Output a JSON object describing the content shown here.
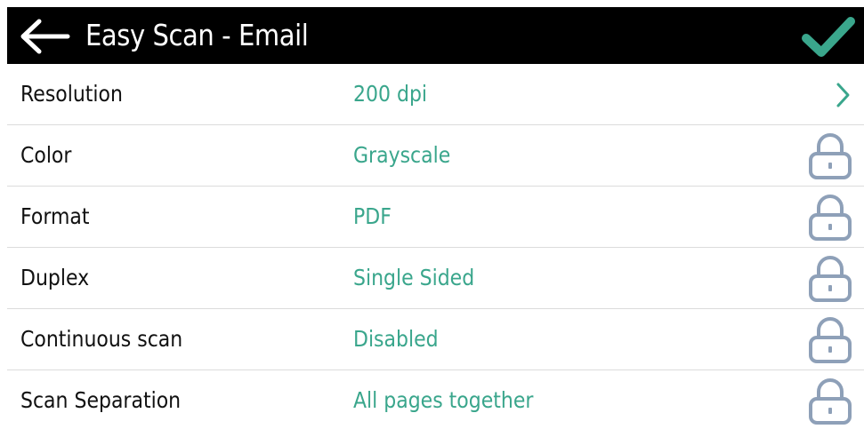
{
  "colors": {
    "header_bg": "#000000",
    "header_text": "#ffffff",
    "accent": "#3aa68c",
    "lock": "#8ea0b8",
    "label": "#111111",
    "divider": "#dcdcdc"
  },
  "header": {
    "back_icon": "arrow-left-icon",
    "title": "Easy Scan - Email",
    "confirm_icon": "checkmark-icon"
  },
  "settings": [
    {
      "label": "Resolution",
      "value": "200 dpi",
      "trailing_icon": "chevron-right-icon",
      "locked": false
    },
    {
      "label": "Color",
      "value": "Grayscale",
      "trailing_icon": "lock-icon",
      "locked": true
    },
    {
      "label": "Format",
      "value": "PDF",
      "trailing_icon": "lock-icon",
      "locked": true
    },
    {
      "label": "Duplex",
      "value": "Single Sided",
      "trailing_icon": "lock-icon",
      "locked": true
    },
    {
      "label": "Continuous scan",
      "value": "Disabled",
      "trailing_icon": "lock-icon",
      "locked": true
    },
    {
      "label": "Scan Separation",
      "value": "All pages together",
      "trailing_icon": "lock-icon",
      "locked": true
    }
  ]
}
